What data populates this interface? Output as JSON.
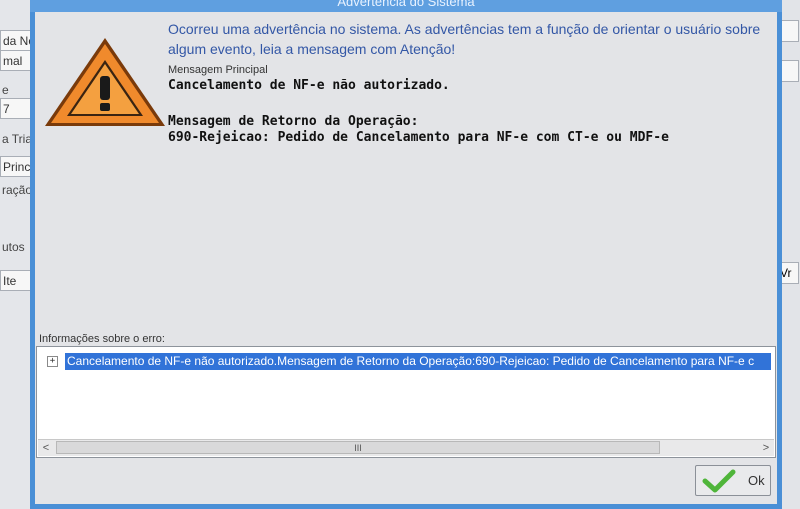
{
  "background_app": {
    "left_fields": [
      "da Not",
      "mal",
      "e",
      "7",
      "a Tria",
      "Princ",
      "ração",
      "utos",
      "Ite"
    ],
    "right_fields": [
      "Vr"
    ]
  },
  "dialog": {
    "title": "Advertência do Sistema",
    "intro": "Ocorreu uma advertência no sistema. As advertências tem a função de orientar o usuário sobre algum evento, leia a mensagem com Atenção!",
    "main_label": "Mensagem Principal",
    "main_message": "Cancelamento de NF-e não autorizado.",
    "return_title": "Mensagem de Retorno da Operação:",
    "return_message": "690-Rejeicao: Pedido de Cancelamento para NF-e com CT-e ou MDF-e",
    "error_info_label": "Informações sobre o erro:",
    "error_tree": {
      "expand_symbol": "+",
      "selected_item": "Cancelamento de NF-e não autorizado.Mensagem de Retorno da Operação:690-Rejeicao: Pedido de Cancelamento para NF-e c"
    },
    "scrollbar": {
      "left": "<",
      "right": ">",
      "thumb": "III"
    },
    "ok_button": {
      "label": "Ok"
    }
  },
  "colors": {
    "accent": "#4a8fd6",
    "intro_text": "#3357a6",
    "selection": "#3173d8",
    "warning_orange": "#f08a2c",
    "check_green": "#4fb53a"
  },
  "icons": {
    "warning": "warning-triangle-icon",
    "ok": "checkmark-icon"
  }
}
